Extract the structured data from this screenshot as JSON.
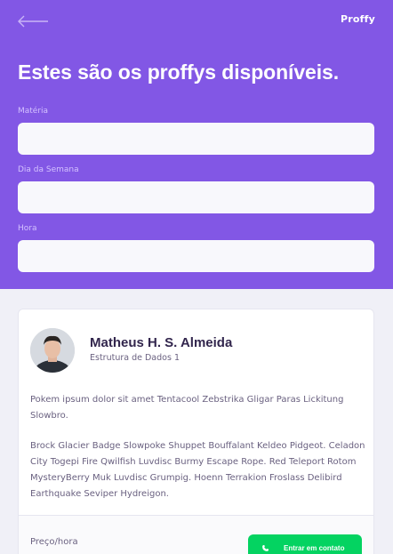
{
  "header": {
    "back_icon": "arrow-left-icon",
    "logo": "Proffy",
    "title": "Estes são os proffys disponíveis."
  },
  "filters": {
    "subject_label": "Matéria",
    "subject_value": "",
    "weekday_label": "Dia da Semana",
    "weekday_value": "",
    "time_label": "Hora",
    "time_value": ""
  },
  "teacher": {
    "name": "Matheus H. S. Almeida",
    "subject": "Estrutura de Dados 1",
    "bio_1": "Pokem ipsum dolor sit amet Tentacool Zebstrika Gligar Paras Lickitung Slowbro.",
    "bio_2": "Brock Glacier Badge Slowpoke Shuppet Bouffalant Keldeo Pidgeot. Celadon City Togepi Fire Qwilfish Luvdisc Burmy Escape Rope. Red Teleport Rotom MysteryBerry Muk Luvdisc Grumpig. Hoenn Terrakion Froslass Delibird Earthquake Seviper Hydreigon.",
    "price_label": "Preço/hora",
    "contact_label": "Entrar em contato",
    "contact_icon": "whatsapp-icon"
  },
  "colors": {
    "primary": "#8257e5",
    "background": "#f0f0f7",
    "title_text": "#32264d",
    "secondary_green": "#04d361"
  }
}
